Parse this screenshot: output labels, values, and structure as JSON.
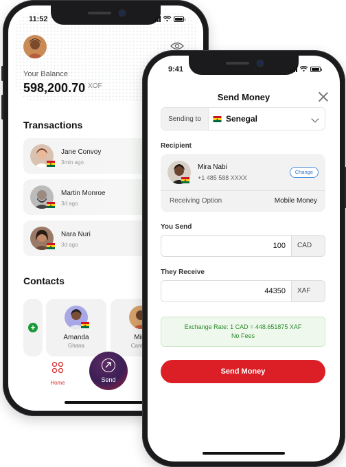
{
  "colors": {
    "accent_red": "#dc1f26",
    "success_green": "#1a9a3a",
    "link_blue": "#2c6fc7"
  },
  "home_screen": {
    "status_time": "11:52",
    "balance_label": "Your Balance",
    "balance_value": "598,200.70",
    "balance_currency": "XOF",
    "transactions_title": "Transactions",
    "transactions": [
      {
        "name": "Jane Convoy",
        "ago": "3min ago"
      },
      {
        "name": "Martin Monroe",
        "ago": "3d ago"
      },
      {
        "name": "Nara Nuri",
        "ago": "3d ago"
      }
    ],
    "contacts_title": "Contacts",
    "contacts": [
      {
        "name": "Amanda",
        "country": "Ghana"
      },
      {
        "name": "Mira",
        "country": "Camero"
      }
    ],
    "nav": {
      "home_label": "Home",
      "send_label": "Send"
    }
  },
  "send_screen": {
    "status_time": "9:41",
    "title": "Send Money",
    "sending_to_label": "Sending to",
    "sending_to_value": "Senegal",
    "recipient_label": "Recipient",
    "recipient": {
      "name": "Mira Nabi",
      "phone": "+1 485 588 XXXX",
      "change_label": "Change",
      "receiving_option_label": "Receiving Option",
      "receiving_option_value": "Mobile Money"
    },
    "you_send_label": "You Send",
    "you_send_amount": "100",
    "you_send_currency": "CAD",
    "they_receive_label": "They Receive",
    "they_receive_amount": "44350",
    "they_receive_currency": "XAF",
    "exchange_rate": "Exchange Rate: 1 CAD = 448.651875 XAF",
    "fees": "No Fees",
    "submit_label": "Send Money"
  }
}
